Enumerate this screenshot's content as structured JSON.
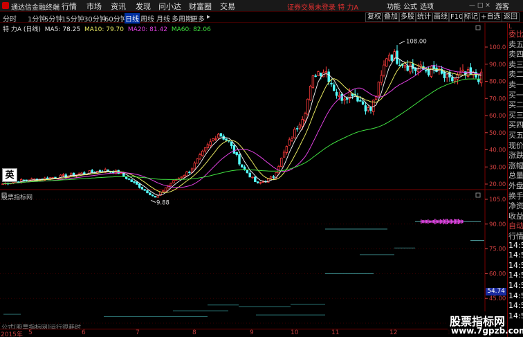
{
  "menubar": {
    "app_name": "通达信金融终端",
    "menus": [
      "行情",
      "市场",
      "资讯",
      "发现",
      "问小达",
      "财富圈",
      "交易"
    ],
    "notice": "证券交易未登录 特 力A",
    "buttons": [
      "功能",
      "公式",
      "选项"
    ],
    "tourist": "游客",
    "window_controls": "— □ ×"
  },
  "toolbar": {
    "periods": [
      "分时",
      "1分钟",
      "5分钟",
      "15分钟",
      "30分钟",
      "60分钟",
      "日线",
      "周线",
      "月线",
      "多周期",
      "更多"
    ],
    "active_period": "日线",
    "more_arrow": "▸",
    "buttons": [
      "复权",
      "叠加",
      "多股",
      "统计",
      "画线",
      "F10",
      "标记",
      "+自选",
      "返回"
    ]
  },
  "legend": {
    "title": "特 力A (日线)",
    "ma5": "MA5: 78.25",
    "ma10": "MA10: 79.70",
    "ma20": "MA20: 81.42",
    "ma60": "MA60: 82.06"
  },
  "colors": {
    "up": "#ff3c3c",
    "down": "#54ffff",
    "ma5": "#e8e8e8",
    "ma10": "#e8e860",
    "ma20": "#e040e0",
    "ma60": "#40e040",
    "axis": "#d04040"
  },
  "annotations": {
    "high": "108.00",
    "low": "9.88"
  },
  "ying_label": "英",
  "indicator": {
    "title": "股票指标网",
    "formula_hint": "公式[股票指标网]运行很耗时",
    "value_badge": "54.74"
  },
  "price_ticks": [
    "100.0",
    "90.00",
    "80.00",
    "70.00",
    "60.00",
    "50.00",
    "40.00",
    "30.00",
    "20.00"
  ],
  "indicator_ticks": [
    "105.0",
    "90.00",
    "75.00",
    "60.00",
    "45.00",
    "30.00"
  ],
  "dates": [
    "2015年",
    "5",
    "6",
    "7",
    "8",
    "9",
    "10",
    "11",
    "12",
    "1"
  ],
  "right_panel": {
    "top": "L",
    "lines": [
      {
        "text": "委比",
        "color": "#d04040"
      },
      {
        "text": "卖五",
        "color": "#c0c0c0"
      },
      {
        "text": "卖四",
        "color": "#c0c0c0"
      },
      {
        "text": "卖三",
        "color": "#c0c0c0"
      },
      {
        "text": "卖二",
        "color": "#c0c0c0"
      },
      {
        "text": "卖一",
        "color": "#c0c0c0"
      },
      {
        "text": "买一",
        "color": "#c0c0c0"
      },
      {
        "text": "买二",
        "color": "#c0c0c0"
      },
      {
        "text": "买三",
        "color": "#c0c0c0"
      },
      {
        "text": "买四",
        "color": "#c0c0c0"
      },
      {
        "text": "买五",
        "color": "#c0c0c0"
      },
      {
        "text": "现价",
        "color": "#c0c0c0"
      },
      {
        "text": "涨跌",
        "color": "#c0c0c0"
      },
      {
        "text": "涨幅",
        "color": "#c0c0c0"
      },
      {
        "text": "总量",
        "color": "#c0c0c0"
      },
      {
        "text": "外盘",
        "color": "#c0c0c0"
      },
      {
        "text": "换手",
        "color": "#c0c0c0"
      },
      {
        "text": "净资",
        "color": "#c0c0c0"
      },
      {
        "text": "收益",
        "color": "#c0c0c0"
      },
      {
        "text": "自动",
        "color": "#d04040"
      },
      {
        "text": "行情",
        "color": "#c0c0c0"
      },
      {
        "text": "14:5",
        "color": "#ffffff"
      },
      {
        "text": "14:5",
        "color": "#ffffff"
      },
      {
        "text": "14:5",
        "color": "#ffffff"
      },
      {
        "text": "14:5",
        "color": "#ffffff"
      },
      {
        "text": "14:5",
        "color": "#ffffff"
      },
      {
        "text": "14:5",
        "color": "#ffffff"
      },
      {
        "text": "14:5",
        "color": "#ffffff"
      },
      {
        "text": "14:5",
        "color": "#ffffff"
      }
    ]
  },
  "watermark": {
    "line1": "股票指标网",
    "line2": "www.7gpzb.com"
  }
}
